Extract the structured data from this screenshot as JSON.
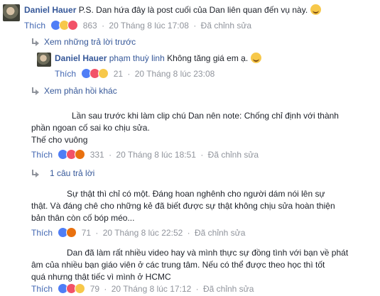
{
  "comments": [
    {
      "author": "Daniel Hauer",
      "text": "P.S. Dan hứa đây là post cuối của Dan liên quan đến vụ này.",
      "like_label": "Thích",
      "reaction_count": "863",
      "time": "20 Tháng 8 lúc 17:08",
      "edited": "Đã chỉnh sửa"
    }
  ],
  "more_replies_link": "Xem những trả lời trước",
  "reply": {
    "author": "Daniel Hauer",
    "mention": "phạm thuỳ linh",
    "text": "Không tăng giá em ạ.",
    "like_label": "Thích",
    "reaction_count": "21",
    "time": "20 Tháng 8 lúc 23:08"
  },
  "other_replies_link": "Xem phản hồi khác",
  "comment2": {
    "line1": "Lần sau trước khi làm clip chú Dan nên note: Chống chỉ định với thành",
    "line2": "phần ngoan cố sai ko chịu sửa.",
    "line3": "Thế cho vuông",
    "like_label": "Thích",
    "reaction_count": "331",
    "time": "20 Tháng 8 lúc 18:51",
    "edited": "Đã chỉnh sửa",
    "replies_link": "1 câu trả lời"
  },
  "comment3": {
    "line1": "Sự thật thì chỉ có một. Đáng hoan nghênh cho người dám nói lên sự",
    "line2": "thật. Và đáng chê cho những kẻ đã biết được sự thật không chịu sửa hoàn thiện",
    "line3": "bản thân còn cố bóp méo...",
    "like_label": "Thích",
    "reaction_count": "71",
    "time": "20 Tháng 8 lúc 22:52",
    "edited": "Đã chỉnh sửa"
  },
  "comment4": {
    "line1": "Dan đã làm rất nhiều video hay và mình thực sự đồng tình với bạn về phát",
    "line2": "âm của nhiều bạn giáo viên ở các trung tâm. Nếu có thể được theo học thì tốt",
    "line3": "quá nhưng thật tiếc vì mình ở HCMC",
    "like_label": "Thích",
    "reaction_count": "79",
    "time": "20 Tháng 8 lúc 17:12",
    "edited": "Đã chỉnh sửa"
  },
  "icons": {
    "reactions": [
      "like-icon",
      "love-icon",
      "haha-icon",
      "wow-icon",
      "angry-icon"
    ],
    "emoji": "smile-emoji-icon",
    "reply_arrow": "reply-arrow-icon"
  },
  "colors": {
    "link": "#365899",
    "meta": "#90949c",
    "text": "#1d2129"
  }
}
